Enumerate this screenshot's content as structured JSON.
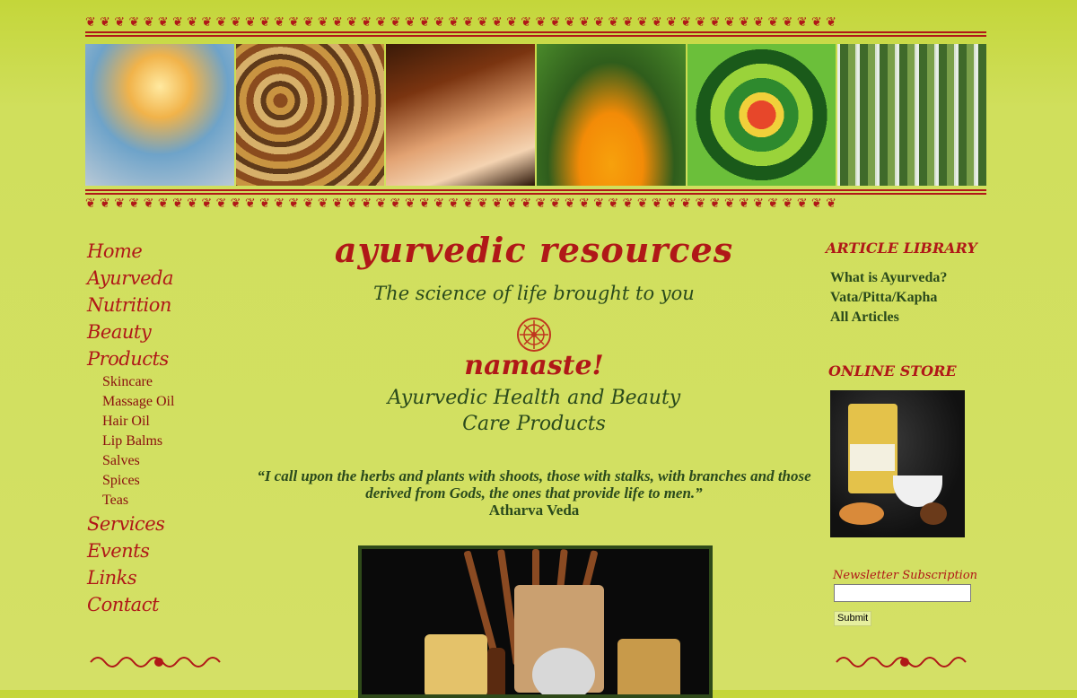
{
  "site": {
    "title": "ayurvedic resources",
    "tagline": "The science of life brought to you",
    "greeting": "namaste!",
    "subheading": "Ayurvedic Health and Beauty Care Products"
  },
  "nav": {
    "items": [
      {
        "label": "Home"
      },
      {
        "label": "Ayurveda"
      },
      {
        "label": "Nutrition"
      },
      {
        "label": "Beauty"
      },
      {
        "label": "Products"
      }
    ],
    "product_subitems": [
      {
        "label": "Skincare"
      },
      {
        "label": "Massage Oil"
      },
      {
        "label": "Hair Oil"
      },
      {
        "label": "Lip Balms"
      },
      {
        "label": "Salves"
      },
      {
        "label": "Spices"
      },
      {
        "label": "Teas"
      }
    ],
    "items_after": [
      {
        "label": "Services"
      },
      {
        "label": "Events"
      },
      {
        "label": "Links"
      },
      {
        "label": "Contact"
      }
    ]
  },
  "quote": {
    "text": "“I call upon the herbs and plants with shoots, those with stalks, with branches and those derived from Gods, the ones that provide life to men.”",
    "author": "Atharva Veda"
  },
  "sidebar": {
    "article_library_heading": "ARTICLE LIBRARY",
    "articles": [
      {
        "label": "What is Ayurveda?"
      },
      {
        "label": "Vata/Pitta/Kapha"
      },
      {
        "label": "All Articles"
      }
    ],
    "store_heading": "ONLINE STORE",
    "newsletter_label": "Newsletter Subscription",
    "newsletter_value": "",
    "submit_label": "Submit"
  },
  "colors": {
    "accent": "#b01818",
    "text_green": "#2a4a1c",
    "background": "#d0df5c"
  },
  "icons": [
    "lotus-icon",
    "border-scroll-icon",
    "swirl-divider-icon"
  ]
}
